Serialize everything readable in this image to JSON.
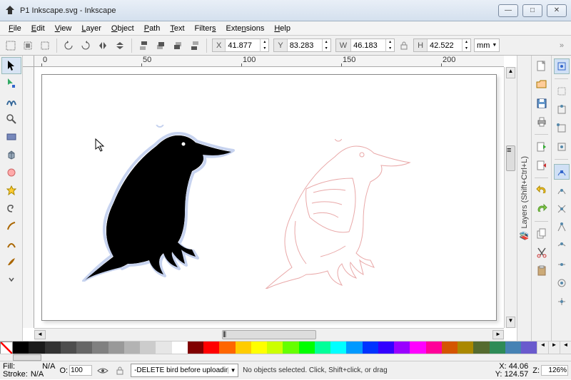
{
  "window": {
    "title": "P1 Inkscape.svg - Inkscape"
  },
  "menu": {
    "items": [
      "File",
      "Edit",
      "View",
      "Layer",
      "Object",
      "Path",
      "Text",
      "Filters",
      "Extensions",
      "Help"
    ]
  },
  "toolbar": {
    "x": "41.877",
    "y": "83.283",
    "w": "46.183",
    "h": "42.522",
    "unit": "mm"
  },
  "layers_panel": {
    "label": "Layers (Shift+Ctrl+L)"
  },
  "palette": {
    "colors": [
      "#000000",
      "#1a1a1a",
      "#333333",
      "#4d4d4d",
      "#666666",
      "#808080",
      "#999999",
      "#b3b3b3",
      "#cccccc",
      "#e6e6e6",
      "#ffffff",
      "#800000",
      "#ff0000",
      "#ff6600",
      "#ffcc00",
      "#ffff00",
      "#ccff00",
      "#66ff00",
      "#00ff00",
      "#00ff99",
      "#00ffff",
      "#0099ff",
      "#0033ff",
      "#3300ff",
      "#9900ff",
      "#ff00ff",
      "#ff0099",
      "#d45500",
      "#aa8800",
      "#556b2f",
      "#2e8b57",
      "#4682b4",
      "#6a5acd"
    ]
  },
  "status": {
    "fill_label": "Fill:",
    "fill_value": "N/A",
    "stroke_label": "Stroke:",
    "stroke_value": "N/A",
    "opacity_label": "O:",
    "opacity_value": "100",
    "layer": "-DELETE bird before uploading",
    "hint": "No objects selected. Click, Shift+click, or drag",
    "cursor_x_label": "X:",
    "cursor_x": "44.06",
    "cursor_y_label": "Y:",
    "cursor_y": "124.57",
    "zoom_label": "Z:",
    "zoom": "126%"
  },
  "ruler": {
    "ticks": [
      "0",
      "50",
      "100",
      "150",
      "200"
    ]
  }
}
